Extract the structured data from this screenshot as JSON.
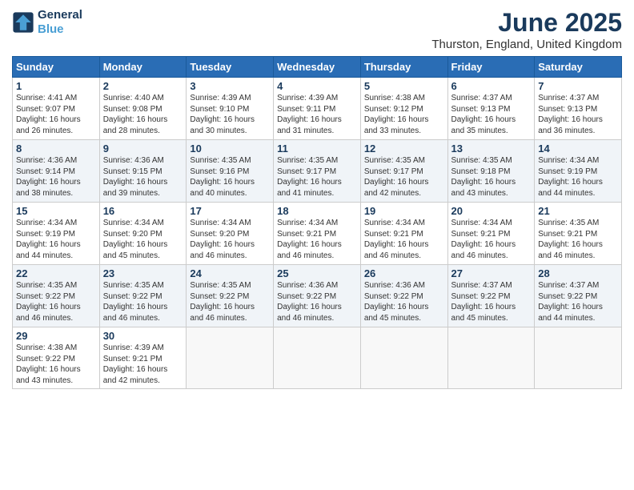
{
  "logo": {
    "line1": "General",
    "line2": "Blue"
  },
  "title": "June 2025",
  "location": "Thurston, England, United Kingdom",
  "headers": [
    "Sunday",
    "Monday",
    "Tuesday",
    "Wednesday",
    "Thursday",
    "Friday",
    "Saturday"
  ],
  "weeks": [
    [
      {
        "day": "1",
        "sunrise": "4:41 AM",
        "sunset": "9:07 PM",
        "daylight": "16 hours and 26 minutes."
      },
      {
        "day": "2",
        "sunrise": "4:40 AM",
        "sunset": "9:08 PM",
        "daylight": "16 hours and 28 minutes."
      },
      {
        "day": "3",
        "sunrise": "4:39 AM",
        "sunset": "9:10 PM",
        "daylight": "16 hours and 30 minutes."
      },
      {
        "day": "4",
        "sunrise": "4:39 AM",
        "sunset": "9:11 PM",
        "daylight": "16 hours and 31 minutes."
      },
      {
        "day": "5",
        "sunrise": "4:38 AM",
        "sunset": "9:12 PM",
        "daylight": "16 hours and 33 minutes."
      },
      {
        "day": "6",
        "sunrise": "4:37 AM",
        "sunset": "9:13 PM",
        "daylight": "16 hours and 35 minutes."
      },
      {
        "day": "7",
        "sunrise": "4:37 AM",
        "sunset": "9:13 PM",
        "daylight": "16 hours and 36 minutes."
      }
    ],
    [
      {
        "day": "8",
        "sunrise": "4:36 AM",
        "sunset": "9:14 PM",
        "daylight": "16 hours and 38 minutes."
      },
      {
        "day": "9",
        "sunrise": "4:36 AM",
        "sunset": "9:15 PM",
        "daylight": "16 hours and 39 minutes."
      },
      {
        "day": "10",
        "sunrise": "4:35 AM",
        "sunset": "9:16 PM",
        "daylight": "16 hours and 40 minutes."
      },
      {
        "day": "11",
        "sunrise": "4:35 AM",
        "sunset": "9:17 PM",
        "daylight": "16 hours and 41 minutes."
      },
      {
        "day": "12",
        "sunrise": "4:35 AM",
        "sunset": "9:17 PM",
        "daylight": "16 hours and 42 minutes."
      },
      {
        "day": "13",
        "sunrise": "4:35 AM",
        "sunset": "9:18 PM",
        "daylight": "16 hours and 43 minutes."
      },
      {
        "day": "14",
        "sunrise": "4:34 AM",
        "sunset": "9:19 PM",
        "daylight": "16 hours and 44 minutes."
      }
    ],
    [
      {
        "day": "15",
        "sunrise": "4:34 AM",
        "sunset": "9:19 PM",
        "daylight": "16 hours and 44 minutes."
      },
      {
        "day": "16",
        "sunrise": "4:34 AM",
        "sunset": "9:20 PM",
        "daylight": "16 hours and 45 minutes."
      },
      {
        "day": "17",
        "sunrise": "4:34 AM",
        "sunset": "9:20 PM",
        "daylight": "16 hours and 46 minutes."
      },
      {
        "day": "18",
        "sunrise": "4:34 AM",
        "sunset": "9:21 PM",
        "daylight": "16 hours and 46 minutes."
      },
      {
        "day": "19",
        "sunrise": "4:34 AM",
        "sunset": "9:21 PM",
        "daylight": "16 hours and 46 minutes."
      },
      {
        "day": "20",
        "sunrise": "4:34 AM",
        "sunset": "9:21 PM",
        "daylight": "16 hours and 46 minutes."
      },
      {
        "day": "21",
        "sunrise": "4:35 AM",
        "sunset": "9:21 PM",
        "daylight": "16 hours and 46 minutes."
      }
    ],
    [
      {
        "day": "22",
        "sunrise": "4:35 AM",
        "sunset": "9:22 PM",
        "daylight": "16 hours and 46 minutes."
      },
      {
        "day": "23",
        "sunrise": "4:35 AM",
        "sunset": "9:22 PM",
        "daylight": "16 hours and 46 minutes."
      },
      {
        "day": "24",
        "sunrise": "4:35 AM",
        "sunset": "9:22 PM",
        "daylight": "16 hours and 46 minutes."
      },
      {
        "day": "25",
        "sunrise": "4:36 AM",
        "sunset": "9:22 PM",
        "daylight": "16 hours and 46 minutes."
      },
      {
        "day": "26",
        "sunrise": "4:36 AM",
        "sunset": "9:22 PM",
        "daylight": "16 hours and 45 minutes."
      },
      {
        "day": "27",
        "sunrise": "4:37 AM",
        "sunset": "9:22 PM",
        "daylight": "16 hours and 45 minutes."
      },
      {
        "day": "28",
        "sunrise": "4:37 AM",
        "sunset": "9:22 PM",
        "daylight": "16 hours and 44 minutes."
      }
    ],
    [
      {
        "day": "29",
        "sunrise": "4:38 AM",
        "sunset": "9:22 PM",
        "daylight": "16 hours and 43 minutes."
      },
      {
        "day": "30",
        "sunrise": "4:39 AM",
        "sunset": "9:21 PM",
        "daylight": "16 hours and 42 minutes."
      },
      null,
      null,
      null,
      null,
      null
    ]
  ]
}
